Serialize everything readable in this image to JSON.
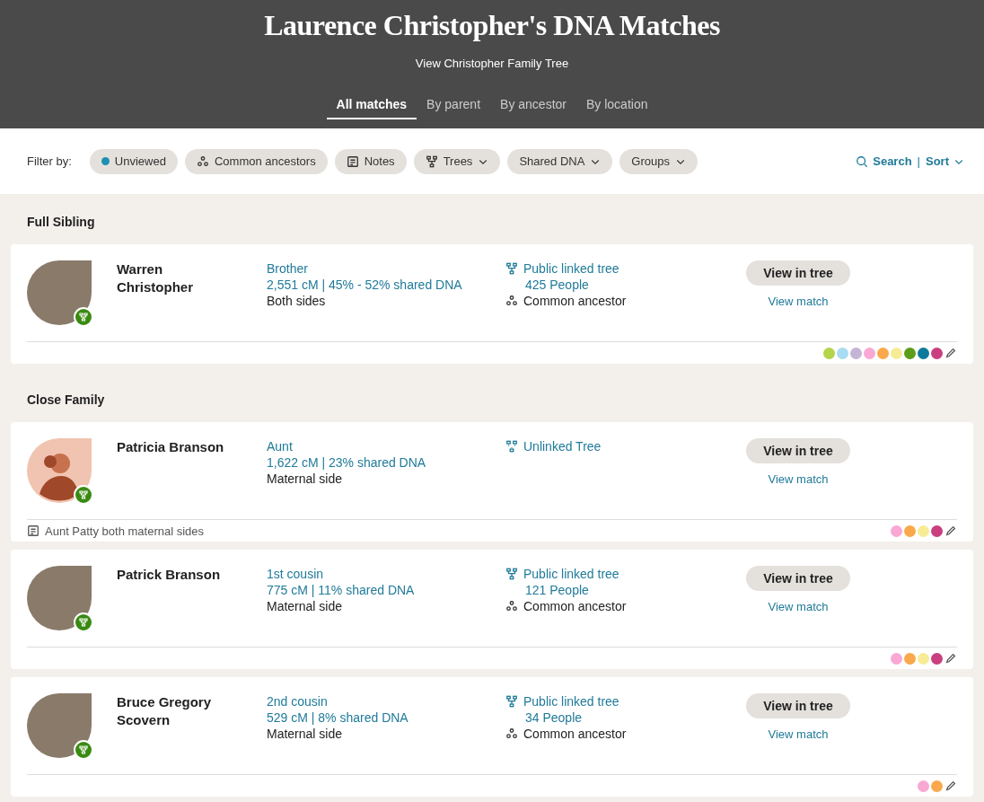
{
  "header": {
    "title": "Laurence Christopher's DNA Matches",
    "tree_link": "View Christopher Family Tree",
    "tabs": [
      {
        "label": "All matches",
        "selected": true
      },
      {
        "label": "By parent",
        "selected": false
      },
      {
        "label": "By ancestor",
        "selected": false
      },
      {
        "label": "By location",
        "selected": false
      }
    ]
  },
  "filters": {
    "label": "Filter by:",
    "chips": [
      {
        "label": "Unviewed",
        "kind": "dot"
      },
      {
        "label": "Common ancestors",
        "kind": "ancestors"
      },
      {
        "label": "Notes",
        "kind": "notes"
      },
      {
        "label": "Trees",
        "kind": "tree-dropdown"
      },
      {
        "label": "Shared DNA",
        "kind": "dropdown"
      },
      {
        "label": "Groups",
        "kind": "dropdown"
      }
    ],
    "search": "Search",
    "separator": "|",
    "sort": "Sort"
  },
  "sections": [
    {
      "title": "Full Sibling",
      "matches": [
        {
          "name": "Warren Christopher",
          "avatar": {
            "kind": "photo"
          },
          "relationship": "Brother",
          "shared_dna": "2,551 cM | 45% - 52% shared DNA",
          "side": "Both sides",
          "tree": {
            "kind": "public",
            "label": "Public linked tree",
            "people": "425 People"
          },
          "common_ancestor": "Common ancestor",
          "view_tree": "View in tree",
          "view_match": "View match",
          "groups": [
            {
              "color": "#b5d44a"
            },
            {
              "color": "#a8dcf2"
            },
            {
              "color": "#c4b5d8"
            },
            {
              "color": "#f9a8d4"
            },
            {
              "color": "#f9a94b"
            },
            {
              "color": "#f7ec96"
            },
            {
              "color": "#5c9d1a"
            },
            {
              "color": "#0e7a99"
            },
            {
              "color": "#c93f7f"
            }
          ]
        }
      ]
    },
    {
      "title": "Close Family",
      "matches": [
        {
          "name": "Patricia Branson",
          "avatar": {
            "kind": "illustration"
          },
          "relationship": "Aunt",
          "shared_dna": "1,622 cM | 23% shared DNA",
          "side": "Maternal side",
          "tree": {
            "kind": "unlinked",
            "label": "Unlinked Tree"
          },
          "view_tree": "View in tree",
          "view_match": "View match",
          "note": "Aunt Patty both maternal sides",
          "groups": [
            {
              "color": "#f9a8d4"
            },
            {
              "color": "#f9a94b"
            },
            {
              "color": "#f7ec96"
            },
            {
              "color": "#c93f7f"
            }
          ]
        },
        {
          "name": "Patrick Branson",
          "avatar": {
            "kind": "photo"
          },
          "relationship": "1st cousin",
          "shared_dna": "775 cM | 11% shared DNA",
          "side": "Maternal side",
          "tree": {
            "kind": "public",
            "label": "Public linked tree",
            "people": "121 People"
          },
          "common_ancestor": "Common ancestor",
          "view_tree": "View in tree",
          "view_match": "View match",
          "groups": [
            {
              "color": "#f9a8d4"
            },
            {
              "color": "#f9a94b"
            },
            {
              "color": "#f7ec96"
            },
            {
              "color": "#c93f7f"
            }
          ]
        },
        {
          "name": "Bruce Gregory Scovern",
          "avatar": {
            "kind": "photo"
          },
          "relationship": "2nd cousin",
          "shared_dna": "529 cM | 8% shared DNA",
          "side": "Maternal side",
          "tree": {
            "kind": "public",
            "label": "Public linked tree",
            "people": "34 People"
          },
          "common_ancestor": "Common ancestor",
          "view_tree": "View in tree",
          "view_match": "View match",
          "groups": [
            {
              "color": "#f9a8d4"
            },
            {
              "color": "#f9a94b"
            }
          ]
        }
      ]
    }
  ]
}
